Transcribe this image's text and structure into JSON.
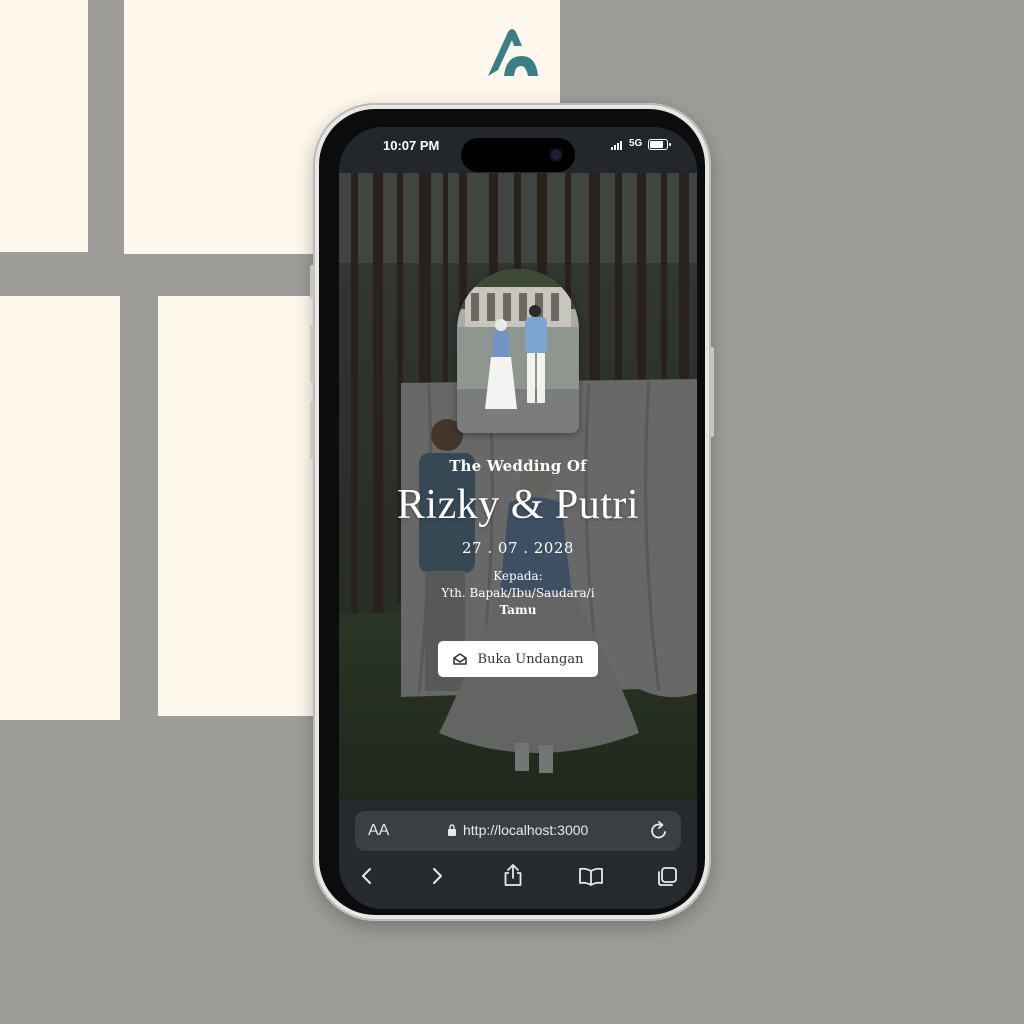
{
  "status_bar": {
    "time": "10:07 PM",
    "network": "5G"
  },
  "invitation": {
    "subtitle": "The Wedding Of",
    "couple_names": "Rizky & Putri",
    "date": "27 . 07 . 2028",
    "recipient_label": "Kepada:",
    "recipient_salutation": "Yth. Bapak/Ibu/Saudara/i",
    "guest_name": "Tamu",
    "open_button_label": "Buka Undangan"
  },
  "browser": {
    "text_size_label": "AA",
    "url": "http://localhost:3000"
  },
  "icons": {
    "logo": "brand-logo-icon",
    "open_button": "envelope-open-icon",
    "lock": "lock-icon",
    "reload": "reload-icon",
    "back": "chevron-left-icon",
    "forward": "chevron-right-icon",
    "share": "share-icon",
    "bookmarks": "book-icon",
    "tabs": "tabs-icon"
  },
  "colors": {
    "logo": "#3a7f86",
    "button_bg": "#ffffff",
    "browser_bar": "#26292d",
    "wall": "#9d9c99"
  }
}
